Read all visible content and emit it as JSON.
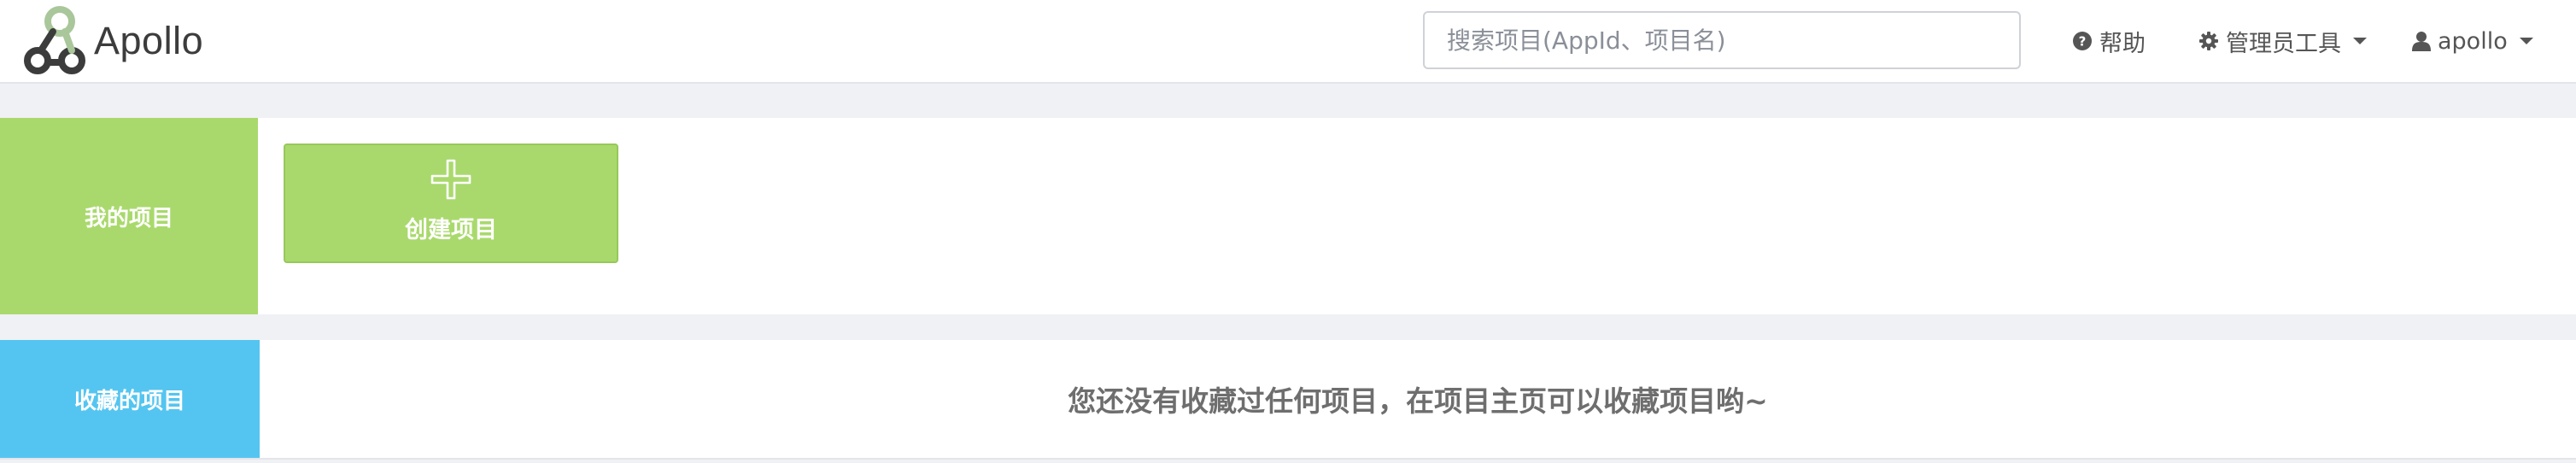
{
  "navbar": {
    "brand_name": "Apollo",
    "logo_icon": "apollo-logo-icon",
    "search": {
      "placeholder": "搜索项目(AppId、项目名)",
      "value": ""
    },
    "help": {
      "icon": "question-circle-icon",
      "label": "帮助"
    },
    "admin_tools": {
      "icon": "gear-icon",
      "label": "管理员工具"
    },
    "user": {
      "icon": "user-icon",
      "label": "apollo"
    }
  },
  "my_projects": {
    "title": "我的项目",
    "create_button": {
      "icon": "plus-icon",
      "label": "创建项目"
    }
  },
  "favorite_projects": {
    "title": "收藏的项目",
    "empty_message": "您还没有收藏过任何项目，在项目主页可以收藏项目哟~"
  },
  "colors": {
    "my_projects_accent": "#a9d96c",
    "favorite_projects_accent": "#54c5f0",
    "page_background": "#f0f1f5",
    "logo_gray": "#3c3c3c",
    "logo_green": "#a9d96c"
  }
}
